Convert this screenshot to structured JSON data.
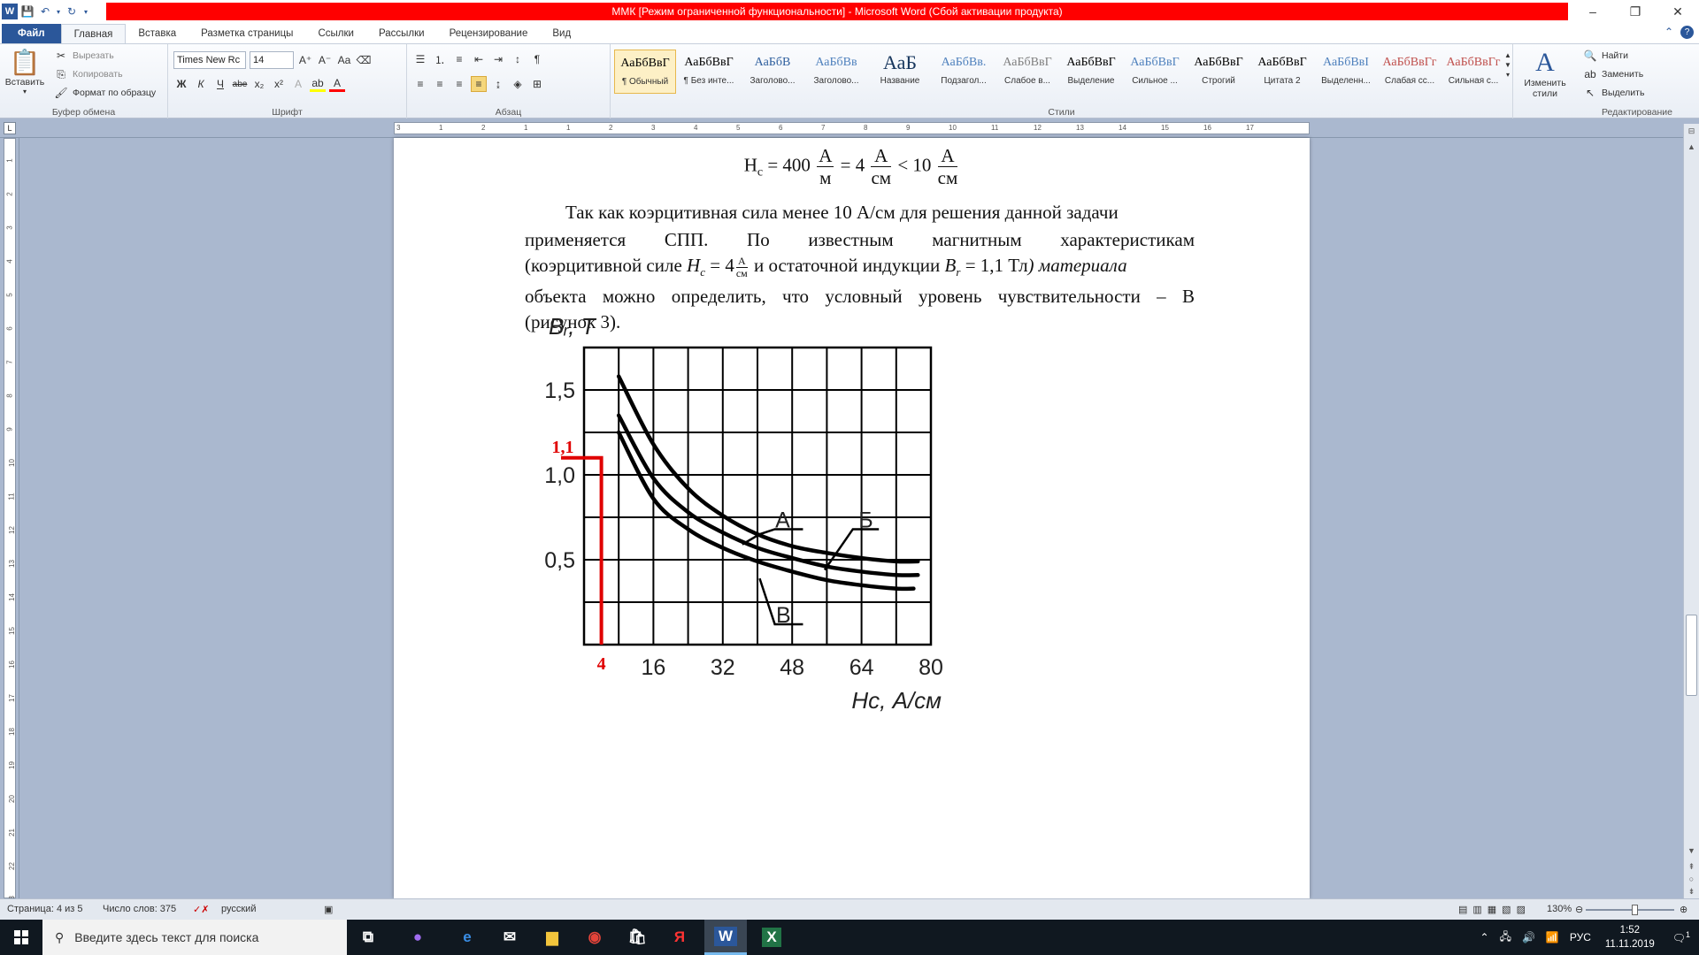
{
  "window": {
    "title": "ММК [Режим ограниченной функциональности]  -  Microsoft Word (Сбой активации продукта)",
    "controls": [
      "–",
      "❐",
      "✕"
    ]
  },
  "tabs": [
    "Файл",
    "Главная",
    "Вставка",
    "Разметка страницы",
    "Ссылки",
    "Рассылки",
    "Рецензирование",
    "Вид"
  ],
  "ribbon": {
    "clipboard": {
      "label": "Буфер обмена",
      "paste": "Вставить",
      "cut": "Вырезать",
      "copy": "Копировать",
      "format_painter": "Формат по образцу"
    },
    "font": {
      "label": "Шрифт",
      "name": "Times New Rc",
      "size": "14"
    },
    "paragraph": {
      "label": "Абзац"
    },
    "styles": {
      "label": "Стили",
      "items": [
        {
          "sample": "АаБбВвГ",
          "name": "¶ Обычный",
          "color": "#000000"
        },
        {
          "sample": "АаБбВвГ",
          "name": "¶ Без инте...",
          "color": "#000000"
        },
        {
          "sample": "АаБбВ",
          "name": "Заголово...",
          "color": "#2e5f9e"
        },
        {
          "sample": "АаБбВв",
          "name": "Заголово...",
          "color": "#4f81bd"
        },
        {
          "sample": "АаБ",
          "name": "Название",
          "color": "#17365d"
        },
        {
          "sample": "АаБбВв.",
          "name": "Подзагол...",
          "color": "#4f81bd"
        },
        {
          "sample": "АаБбВвГ",
          "name": "Слабое в...",
          "color": "#7f7f7f"
        },
        {
          "sample": "АаБбВвГ",
          "name": "Выделение",
          "color": "#000000"
        },
        {
          "sample": "АаБбВвГ",
          "name": "Сильное ...",
          "color": "#4f81bd"
        },
        {
          "sample": "АаБбВвГ",
          "name": "Строгий",
          "color": "#000000"
        },
        {
          "sample": "АаБбВвГ",
          "name": "Цитата 2",
          "color": "#000000"
        },
        {
          "sample": "АаБбВвІ",
          "name": "Выделенн...",
          "color": "#4f81bd"
        },
        {
          "sample": "АаБбВвГг",
          "name": "Слабая сс...",
          "color": "#c0504d"
        },
        {
          "sample": "АаБбВвГг",
          "name": "Сильная с...",
          "color": "#c0504d"
        }
      ],
      "change": "Изменить стили"
    },
    "editing": {
      "label": "Редактирование",
      "find": "Найти",
      "replace": "Заменить",
      "select": "Выделить"
    }
  },
  "ruler": {
    "h": [
      "3",
      "1",
      "2",
      "1",
      "1",
      "2",
      "3",
      "4",
      "5",
      "6",
      "7",
      "8",
      "9",
      "10",
      "11",
      "12",
      "13",
      "14",
      "15",
      "16",
      "17"
    ],
    "v": [
      "1",
      "2",
      "3",
      "4",
      "5",
      "6",
      "7",
      "8",
      "9",
      "10",
      "11",
      "12",
      "13",
      "14",
      "15",
      "16",
      "17",
      "18",
      "19",
      "20",
      "21",
      "22",
      "23",
      "24",
      "25"
    ]
  },
  "document": {
    "formula": {
      "lhs": "H",
      "lhs_sub": "c",
      "eq1": "= 400",
      "f1_num": "А",
      "f1_den": "м",
      "eq2": "= 4",
      "f2_num": "А",
      "f2_den": "см",
      "eq3": "< 10",
      "f3_num": "А",
      "f3_den": "см"
    },
    "line1": "Так как коэрцитивная сила менее 10 А/см для решения данной задачи",
    "line2_words": [
      "применяется",
      "СПП.",
      "По",
      "известным",
      "магнитным",
      "характеристикам"
    ],
    "line3": {
      "a": "(коэрцитивной силе ",
      "h": "H",
      "hsub": "c",
      "eq": " = 4",
      "fnum": "А",
      "fden": "см",
      "b": " и остаточной индукции ",
      "br": "B",
      "brsub": "r",
      "c": " = 1,1 Тл",
      "d": ") материала"
    },
    "line4_words": [
      "объекта",
      "можно",
      "определить,",
      "что",
      "условный",
      "уровень",
      "чувствительности",
      "–",
      "В"
    ],
    "line5": "(рисунок 3)."
  },
  "chart_data": {
    "type": "line",
    "ylabel": "Bᵣ, Т",
    "xlabel": "Hc, А/см",
    "xlim": [
      0,
      80
    ],
    "ylim": [
      0,
      1.75
    ],
    "x_tick_labels": [
      "16",
      "32",
      "48",
      "64",
      "80"
    ],
    "x_ticks": [
      16,
      32,
      48,
      64,
      80
    ],
    "y_tick_labels": [
      "0,5",
      "1,0",
      "1,5"
    ],
    "y_ticks": [
      0.5,
      1.0,
      1.5
    ],
    "grid": true,
    "series": [
      {
        "name": "А",
        "x": [
          8,
          16,
          24,
          32,
          40,
          48,
          56,
          64,
          72,
          77
        ],
        "y": [
          1.58,
          1.18,
          0.92,
          0.76,
          0.65,
          0.58,
          0.54,
          0.51,
          0.49,
          0.49
        ]
      },
      {
        "name": "Б",
        "x": [
          8,
          16,
          24,
          32,
          40,
          48,
          56,
          64,
          72,
          77
        ],
        "y": [
          1.35,
          0.98,
          0.78,
          0.66,
          0.57,
          0.51,
          0.46,
          0.43,
          0.41,
          0.41
        ]
      },
      {
        "name": "В",
        "x": [
          8,
          16,
          24,
          32,
          40,
          48,
          56,
          64,
          72,
          76
        ],
        "y": [
          1.25,
          0.86,
          0.68,
          0.57,
          0.49,
          0.43,
          0.38,
          0.35,
          0.33,
          0.33
        ]
      }
    ],
    "marker": {
      "x": 4,
      "y": 1.1,
      "x_label": "4",
      "y_label": "1,1",
      "color": "#e00000"
    },
    "line_color": "#000000"
  },
  "status": {
    "page": "Страница: 4 из 5",
    "words": "Число слов: 375",
    "lang": "русский",
    "zoom": "130%"
  },
  "taskbar": {
    "search_placeholder": "Введите здесь текст для поиска",
    "lang": "РУС",
    "time": "1:52",
    "date": "11.11.2019",
    "notif": "1"
  }
}
